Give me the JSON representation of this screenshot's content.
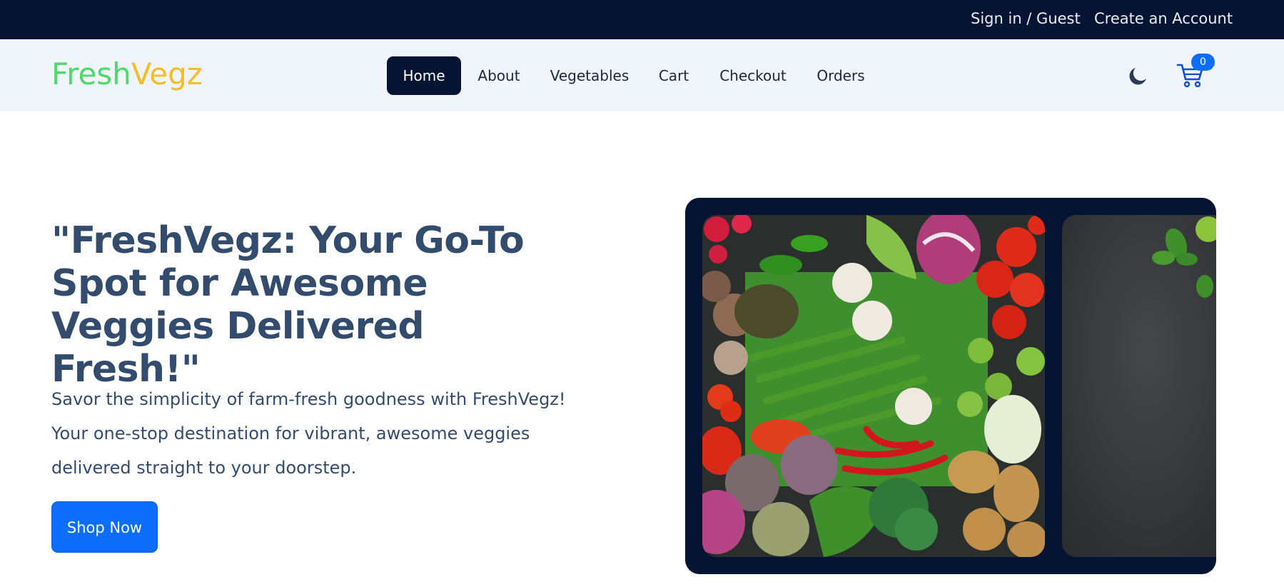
{
  "topbar": {
    "signin_label": "Sign in / Guest",
    "create_account_label": "Create an Account"
  },
  "brand": {
    "part1": "Fresh",
    "part2": "Vegz",
    "color_part1": "#4ed96b",
    "color_part2": "#f6bd26"
  },
  "nav": {
    "items": [
      {
        "label": "Home",
        "active": true
      },
      {
        "label": "About",
        "active": false
      },
      {
        "label": "Vegetables",
        "active": false
      },
      {
        "label": "Cart",
        "active": false
      },
      {
        "label": "Checkout",
        "active": false
      },
      {
        "label": "Orders",
        "active": false
      }
    ],
    "theme_toggle_icon": "moon-icon",
    "cart_icon": "cart-icon",
    "cart_count": "0"
  },
  "hero": {
    "title": "\"FreshVegz: Your Go-To Spot for Awesome Veggies Delivered Fresh!\"",
    "description": "Savor the simplicity of farm-fresh goodness with FreshVegz! Your one-stop destination for vibrant, awesome veggies delivered straight to your doorstep.",
    "cta_label": "Shop Now"
  },
  "carousel": {
    "slides": [
      {
        "image": "assorted-vegetables-photo"
      },
      {
        "image": "dark-slate-with-herbs-photo"
      }
    ]
  },
  "colors": {
    "navy": "#051433",
    "primary": "#0d6efd",
    "nav_bg": "#f0f5fc",
    "heading": "#334c6e"
  }
}
